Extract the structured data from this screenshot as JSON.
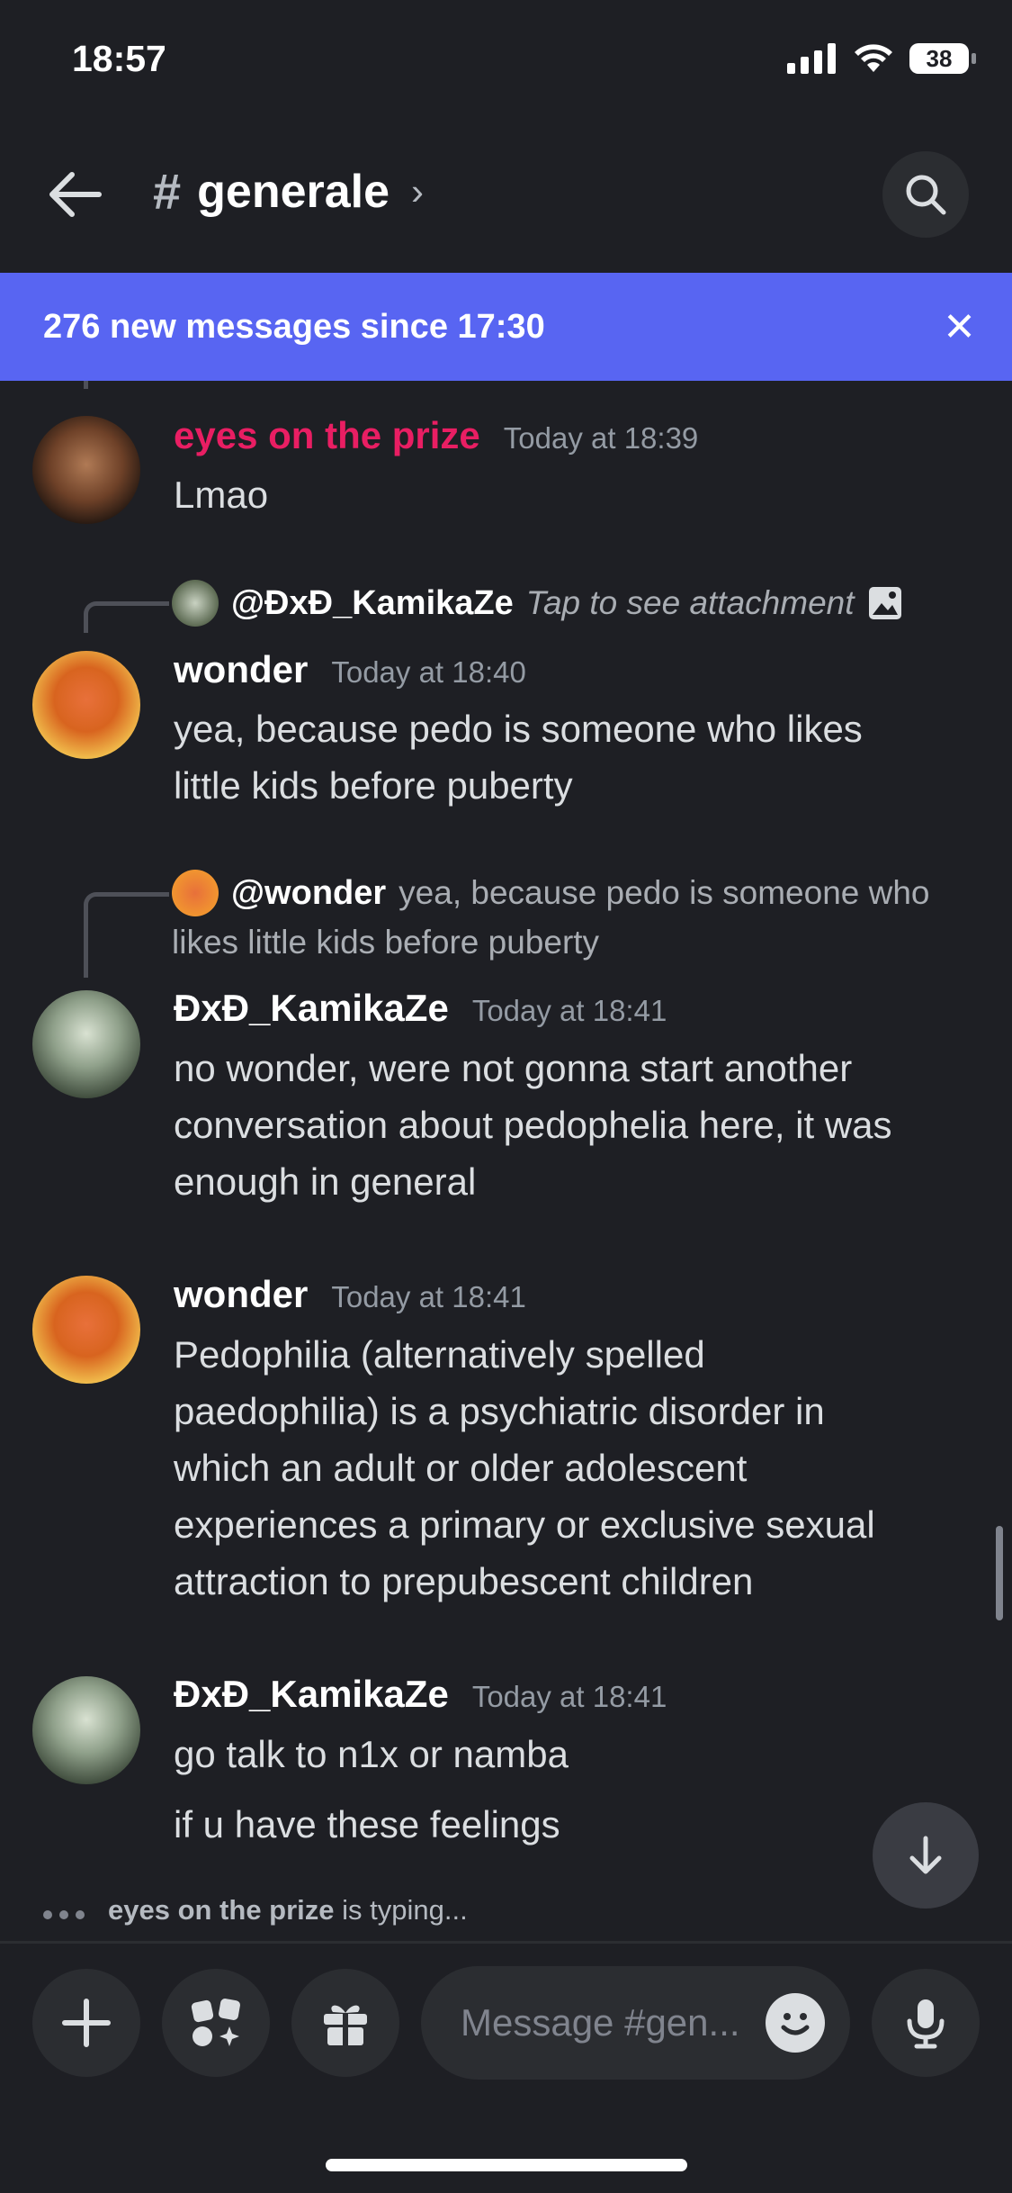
{
  "status": {
    "time": "18:57",
    "battery": "38"
  },
  "header": {
    "channel": "generale"
  },
  "banner": {
    "text": "276 new messages since 17:30"
  },
  "messages": [
    {
      "author": "eyes on the prize",
      "time": "Today at 18:39",
      "lines": [
        "Lmao"
      ],
      "name_color": "#e91e63"
    },
    {
      "reply": {
        "name": "@ĐxĐ_KamikaZe",
        "text": "Tap to see attachment"
      },
      "author": "wonder",
      "time": "Today at 18:40",
      "lines": [
        "yea, because pedo is someone who likes",
        "little kids before puberty"
      ]
    },
    {
      "reply": {
        "name": "@wonder",
        "text1": "yea, because pedo is someone who",
        "text2": "likes little kids before puberty"
      },
      "author": "ĐxĐ_KamikaZe",
      "time": "Today at 18:41",
      "lines": [
        "no wonder, were not gonna start another",
        "conversation about pedophelia here, it was",
        "enough in general"
      ]
    },
    {
      "author": "wonder",
      "time": "Today at 18:41",
      "lines": [
        "Pedophilia (alternatively spelled",
        "paedophilia) is a psychiatric disorder in",
        "which an adult or older adolescent",
        "experiences a primary or exclusive sexual",
        "attraction to prepubescent children"
      ]
    },
    {
      "author": "ĐxĐ_KamikaZe",
      "time": "Today at 18:41",
      "lines": [
        "go talk to n1x or namba",
        "if u have these feelings"
      ]
    }
  ],
  "typing": {
    "user": "eyes on the prize",
    "suffix": "is typing..."
  },
  "composer": {
    "placeholder": "Message #gen..."
  }
}
